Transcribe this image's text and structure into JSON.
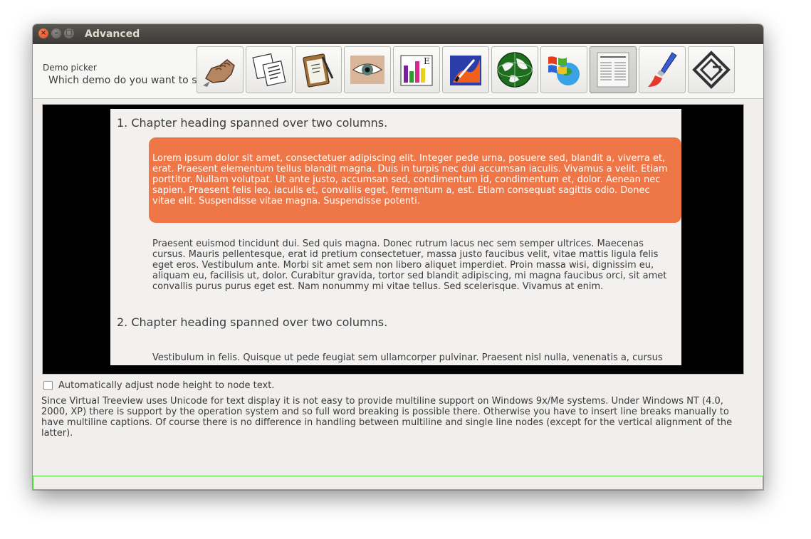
{
  "window": {
    "title": "Advanced"
  },
  "header": {
    "picker_label": "Demo picker",
    "picker_question": "Which demo do you want to see?"
  },
  "toolbar": {
    "buttons": [
      {
        "icon": "fist-icon"
      },
      {
        "icon": "documents-icon"
      },
      {
        "icon": "clipboard-icon"
      },
      {
        "icon": "eye-icon"
      },
      {
        "icon": "chart-icon"
      },
      {
        "icon": "paint-icon"
      },
      {
        "icon": "globe-icon"
      },
      {
        "icon": "windows-icon"
      },
      {
        "icon": "page-layout-icon",
        "active": true
      },
      {
        "icon": "paintbrush-icon"
      },
      {
        "icon": "diamond-logo-icon"
      }
    ]
  },
  "content": {
    "heading1": "1. Chapter heading spanned over two columns.",
    "callout": "Lorem ipsum dolor sit amet, consectetuer adipiscing elit. Integer pede urna, posuere sed, blandit a, viverra et, erat. Praesent elementum tellus blandit magna. Duis in turpis nec dui accumsan iaculis. Vivamus a velit. Etiam porttitor. Nullam volutpat. Ut ante justo, accumsan sed, condimentum id, condimentum et, dolor. Aenean nec sapien. Praesent felis leo, iaculis et, convallis eget, fermentum a, est. Etiam consequat sagittis odio. Donec vitae elit. Suspendisse vitae magna. Suspendisse potenti.",
    "paragraph1": "Praesent euismod tincidunt dui. Sed quis magna. Donec rutrum lacus nec sem semper ultrices. Maecenas cursus. Mauris pellentesque, erat id pretium consectetuer, massa justo faucibus velit, vitae mattis ligula felis eget eros. Vestibulum ante. Morbi sit amet sem non libero aliquet imperdiet. Proin massa wisi, dignissim eu, aliquam eu, facilisis ut, dolor. Curabitur gravida, tortor sed blandit adipiscing, mi magna faucibus orci, sit amet convallis purus purus eget est. Nam nonummy mi vitae tellus. Sed scelerisque. Vivamus at enim.",
    "heading2": "2. Chapter heading spanned over two columns.",
    "paragraph2": "Vestibulum in felis. Quisque ut pede feugiat sem ullamcorper pulvinar. Praesent nisl nulla, venenatis a, cursus"
  },
  "options": {
    "auto_adjust_label": "Automatically adjust node height to node text.",
    "auto_adjust_checked": false
  },
  "info_text": "Since Virtual Treeview uses Unicode for text display it is not easy to provide multiline support on Windows 9x/Me systems. Under Windows NT (4.0, 2000, XP) there is support by the operation system and so full word breaking is possible there. Otherwise you have to insert line breaks manually to have multiline captions. Of course there is no difference in handling between multiline and single line nodes (except for the vertical alignment of the latter).",
  "colors": {
    "callout": "#ef7646",
    "status_border": "#4dde3c"
  }
}
